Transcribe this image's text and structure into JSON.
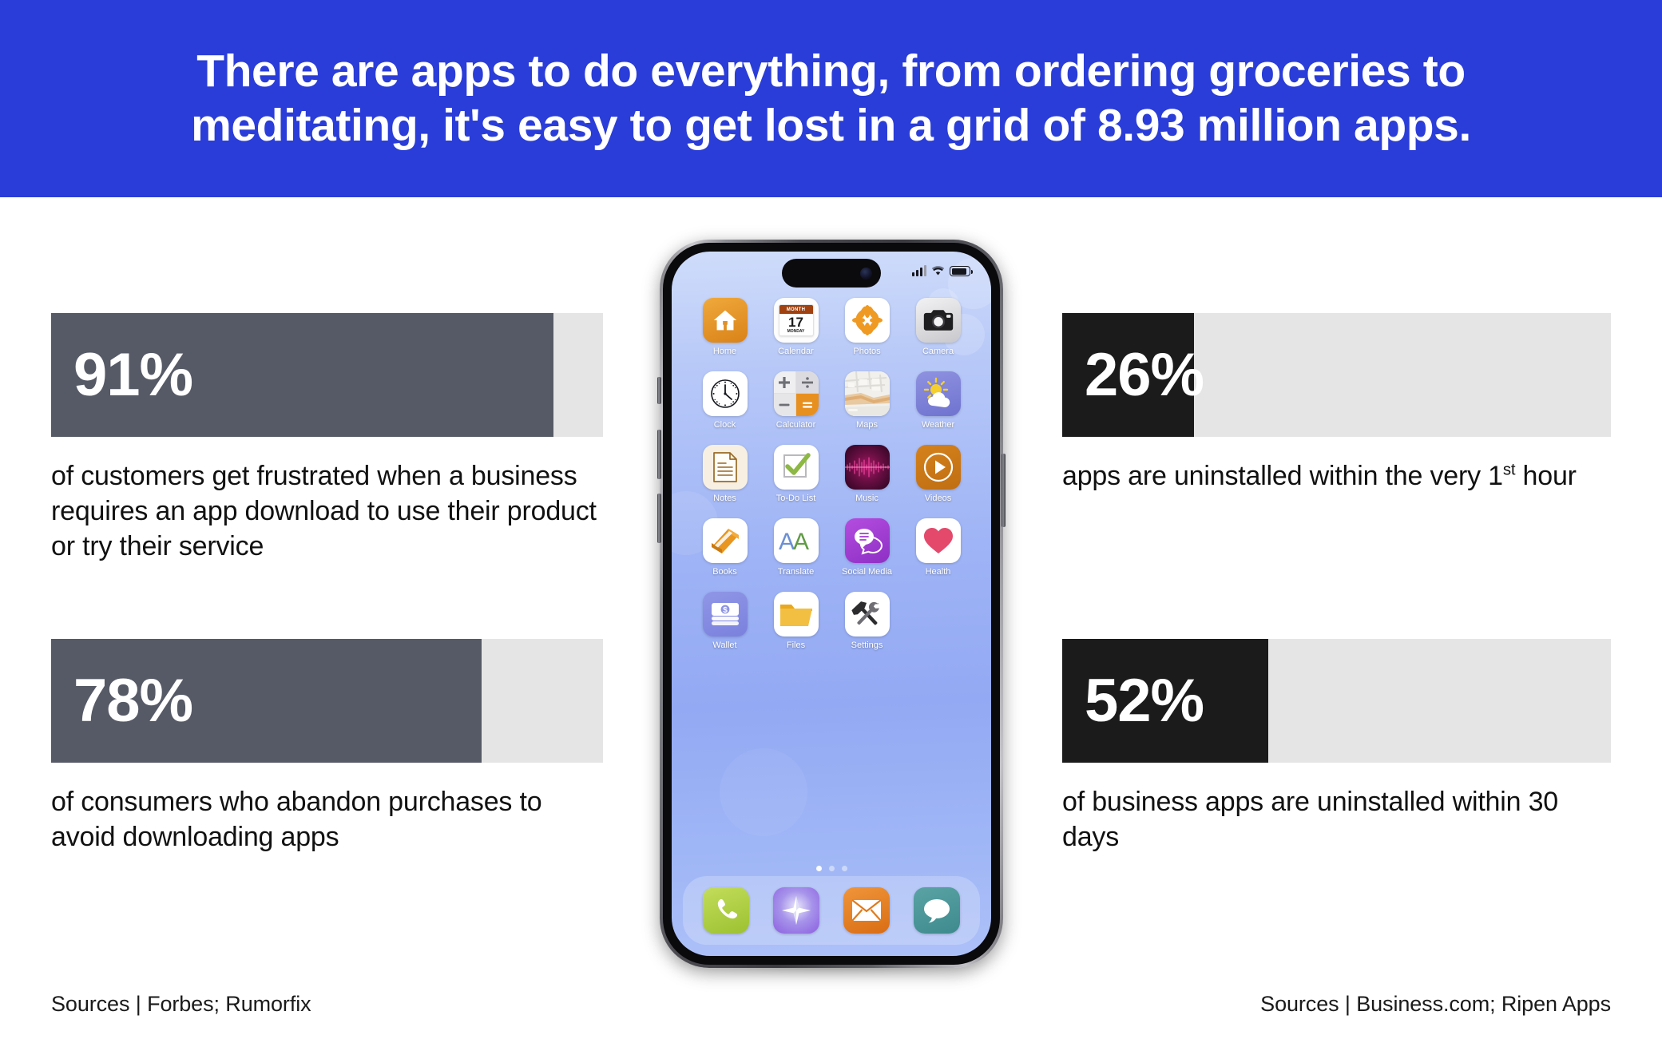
{
  "header": {
    "title": "There are apps to do everything, from ordering groceries to meditating, it's easy to get lost in a grid of 8.93 million apps.",
    "background_color": "#2A3DD8",
    "text_color": "#FFFFFF"
  },
  "stats": [
    {
      "id": "stat-91",
      "value": "91%",
      "percent": 91,
      "caption": "of customers get frustrated when a business requires an app download to use their product or try their service",
      "fill_color": "#565A66",
      "track_color": "#E5E5E5",
      "side": "left"
    },
    {
      "id": "stat-78",
      "value": "78%",
      "percent": 78,
      "caption": "of consumers who abandon purchases to avoid downloading apps",
      "fill_color": "#565A66",
      "track_color": "#E5E5E5",
      "side": "left"
    },
    {
      "id": "stat-26",
      "value": "26%",
      "percent": 26,
      "caption_prefix": "apps are uninstalled within the very 1",
      "caption_sup": "st",
      "caption_suffix": " hour",
      "caption": "apps are uninstalled within the very 1st hour",
      "fill_color": "#1B1B1B",
      "track_color": "#E5E5E5",
      "side": "right"
    },
    {
      "id": "stat-52",
      "value": "52%",
      "percent": 52,
      "caption": "of business apps are uninstalled within 30 days",
      "fill_color": "#1B1B1B",
      "track_color": "#E5E5E5",
      "side": "right"
    }
  ],
  "sources": {
    "left": "Sources | Forbes; Rumorfix",
    "right": "Sources | Business.com; Ripen Apps"
  },
  "phone": {
    "status_bar": {
      "signal_icon": "cellular-signal-icon",
      "wifi_icon": "wifi-icon",
      "battery_icon": "battery-icon",
      "battery_level": 88
    },
    "calendar_icon": {
      "month_label": "MONTH",
      "day_number": "17",
      "weekday_label": "MONDAY"
    },
    "page_dots": {
      "count": 3,
      "active_index": 0
    },
    "apps": [
      {
        "label": "Home",
        "icon": "house-icon"
      },
      {
        "label": "Calendar",
        "icon": "calendar-icon"
      },
      {
        "label": "Photos",
        "icon": "flower-photos-icon"
      },
      {
        "label": "Camera",
        "icon": "camera-icon"
      },
      {
        "label": "Clock",
        "icon": "clock-icon"
      },
      {
        "label": "Calculator",
        "icon": "calculator-icon"
      },
      {
        "label": "Maps",
        "icon": "map-icon"
      },
      {
        "label": "Weather",
        "icon": "sun-cloud-icon"
      },
      {
        "label": "Notes",
        "icon": "document-notes-icon"
      },
      {
        "label": "To-Do List",
        "icon": "checkbox-check-icon"
      },
      {
        "label": "Music",
        "icon": "waveform-music-icon"
      },
      {
        "label": "Videos",
        "icon": "play-circle-icon"
      },
      {
        "label": "Books",
        "icon": "book-icon"
      },
      {
        "label": "Translate",
        "icon": "double-a-translate-icon"
      },
      {
        "label": "Social Media",
        "icon": "chat-bubbles-icon"
      },
      {
        "label": "Health",
        "icon": "heart-icon"
      },
      {
        "label": "Wallet",
        "icon": "money-stack-icon"
      },
      {
        "label": "Files",
        "icon": "folder-icon"
      },
      {
        "label": "Settings",
        "icon": "hammer-wrench-icon"
      }
    ],
    "dock": [
      {
        "label": "Phone",
        "icon": "phone-handset-icon"
      },
      {
        "label": "Compass",
        "icon": "compass-star-icon"
      },
      {
        "label": "Mail",
        "icon": "envelope-icon"
      },
      {
        "label": "Messages",
        "icon": "speech-bubble-icon"
      }
    ]
  }
}
